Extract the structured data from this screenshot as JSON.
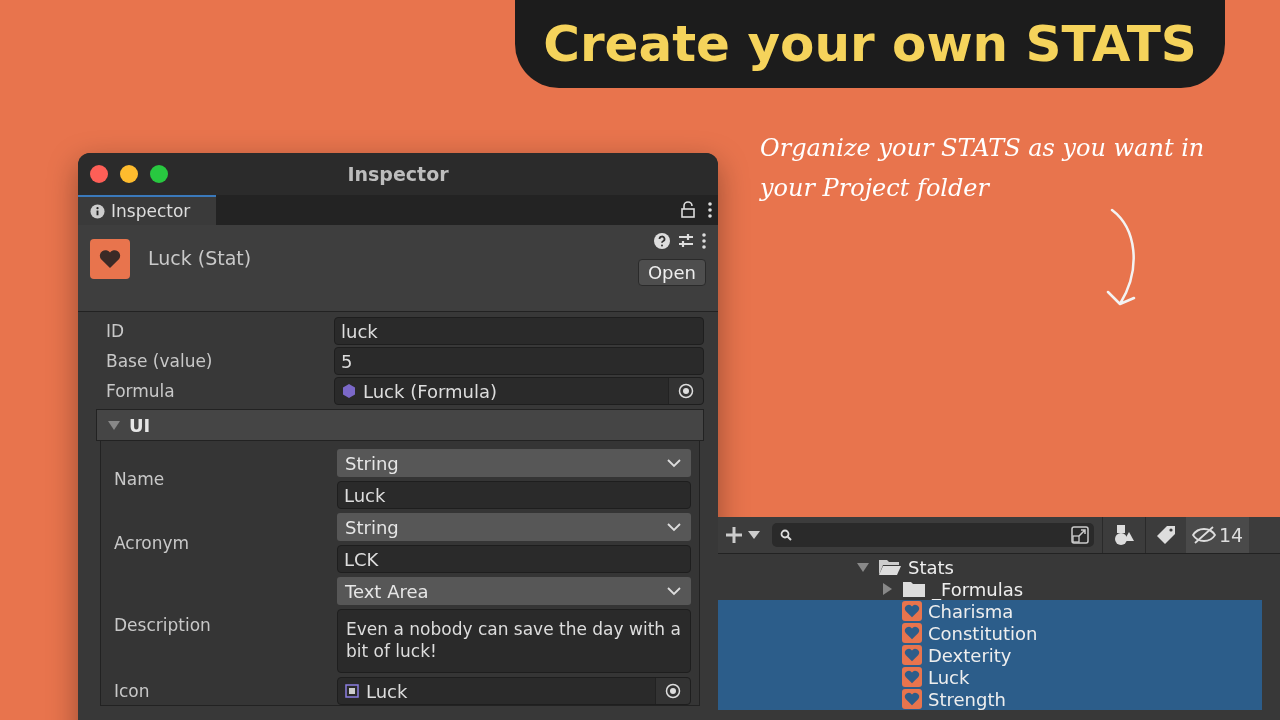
{
  "banner": {
    "title": "Create your own STATS"
  },
  "note": {
    "text": "Organize your STATS as you want in your Project folder"
  },
  "inspector": {
    "window_title": "Inspector",
    "tabs": [
      {
        "label": "Inspector",
        "selected": true
      }
    ],
    "header": {
      "title": "Luck (Stat)",
      "open_button": "Open"
    },
    "fields": [
      {
        "label": "ID",
        "kind": "text",
        "value": "luck"
      },
      {
        "label": "Base (value)",
        "kind": "text",
        "value": "5"
      },
      {
        "label": "Formula",
        "kind": "formula",
        "value": "Luck (Formula)"
      }
    ],
    "section": {
      "title": "UI",
      "expanded": true,
      "fields": [
        {
          "label": "Name",
          "mode": "String",
          "kind": "text",
          "value": "Luck"
        },
        {
          "label": "Acronym",
          "mode": "String",
          "kind": "text",
          "value": "LCK"
        },
        {
          "label": "Description",
          "mode": "Text Area",
          "kind": "area",
          "value": "Even a nobody can save the day with a bit of luck!"
        },
        {
          "label": "Icon",
          "kind": "sprite",
          "value": "Luck"
        }
      ]
    }
  },
  "project": {
    "hidden_count": "14",
    "tree": [
      {
        "label": "Stats",
        "kind": "folder",
        "expanded": true,
        "selected": false,
        "children": [
          {
            "label": "_Formulas",
            "kind": "folder",
            "expanded": false,
            "selected": false
          },
          {
            "label": "Charisma",
            "kind": "stat",
            "selected": true
          },
          {
            "label": "Constitution",
            "kind": "stat",
            "selected": true
          },
          {
            "label": "Dexterity",
            "kind": "stat",
            "selected": true
          },
          {
            "label": "Luck",
            "kind": "stat",
            "selected": true
          },
          {
            "label": "Strength",
            "kind": "stat",
            "selected": true
          }
        ]
      }
    ]
  }
}
